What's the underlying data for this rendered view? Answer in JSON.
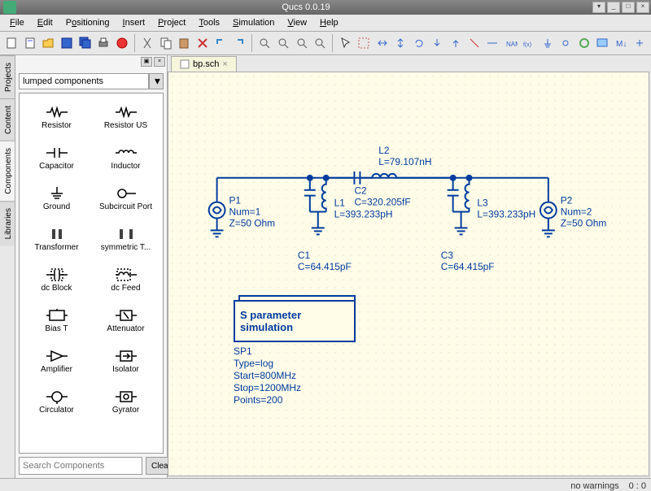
{
  "app_title": "Qucs 0.0.19",
  "menu": [
    "File",
    "Edit",
    "Positioning",
    "Insert",
    "Project",
    "Tools",
    "Simulation",
    "View",
    "Help"
  ],
  "category": "lumped components",
  "palette": [
    "Resistor",
    "Resistor US",
    "Capacitor",
    "Inductor",
    "Ground",
    "Subcircuit Port",
    "Transformer",
    "symmetric T...",
    "dc Block",
    "dc Feed",
    "Bias T",
    "Attenuator",
    "Amplifier",
    "Isolator",
    "Circulator",
    "Gyrator"
  ],
  "search_placeholder": "Search Components",
  "clear_label": "Clear",
  "file_tab": "bp.sch",
  "sim_title1": "S parameter",
  "sim_title2": "simulation",
  "sim": {
    "name": "SP1",
    "type": "Type=log",
    "start": "Start=800MHz",
    "stop": "Stop=1200MHz",
    "points": "Points=200"
  },
  "comp": {
    "P1": {
      "name": "P1",
      "num": "Num=1",
      "z": "Z=50 Ohm"
    },
    "P2": {
      "name": "P2",
      "num": "Num=2",
      "z": "Z=50 Ohm"
    },
    "L1": {
      "name": "L1",
      "val": "L=393.233pH"
    },
    "L2": {
      "name": "L2",
      "val": "L=79.107nH"
    },
    "L3": {
      "name": "L3",
      "val": "L=393.233pH"
    },
    "C1": {
      "name": "C1",
      "val": "C=64.415pF"
    },
    "C2": {
      "name": "C2",
      "val": "C=320.205fF"
    },
    "C3": {
      "name": "C3",
      "val": "C=64.415pF"
    }
  },
  "status": {
    "warn": "no warnings",
    "coord": "0 : 0"
  }
}
